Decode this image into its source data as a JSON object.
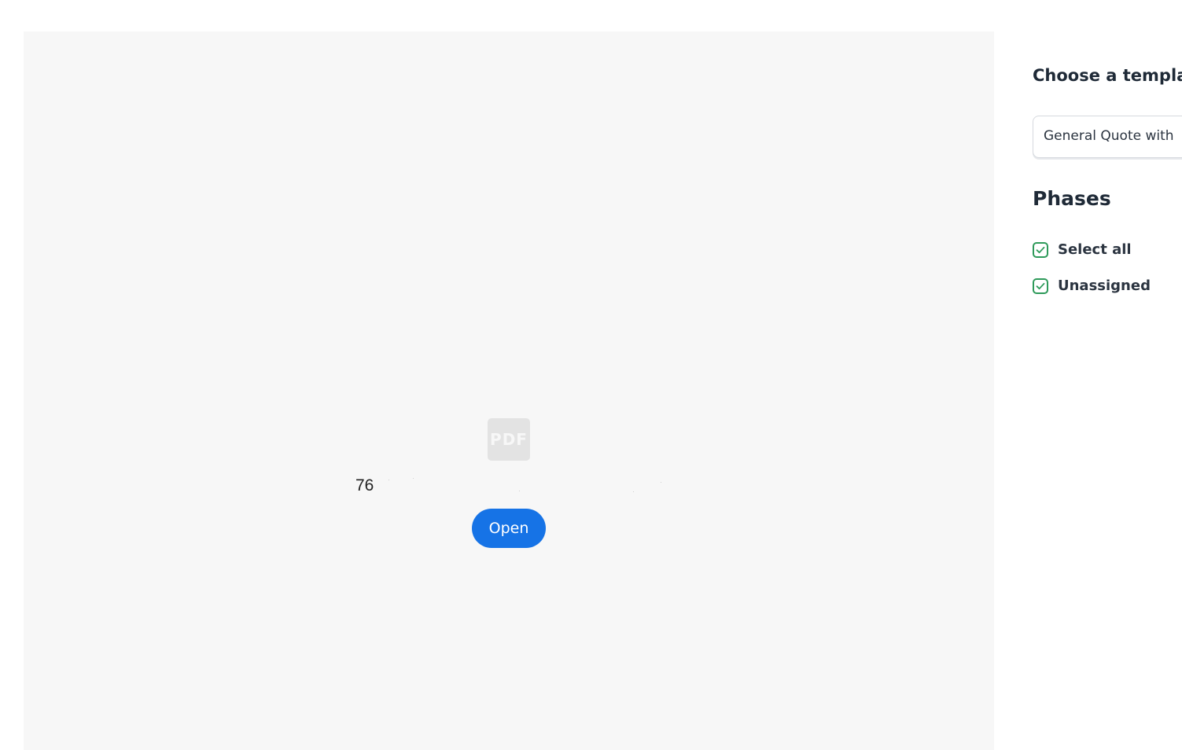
{
  "preview": {
    "pdf_icon_text": "PDF",
    "file_name": "76",
    "open_label": "Open"
  },
  "side_panel": {
    "template_heading": "Choose a templa",
    "template_value": "General Quote with",
    "phases_heading": "Phases",
    "options": [
      {
        "label": "Select all",
        "checked": true
      },
      {
        "label": "Unassigned",
        "checked": true
      }
    ]
  },
  "colors": {
    "accent": "#1673e6",
    "check": "#2e9a5a",
    "preview_bg": "#f7f7f7"
  }
}
